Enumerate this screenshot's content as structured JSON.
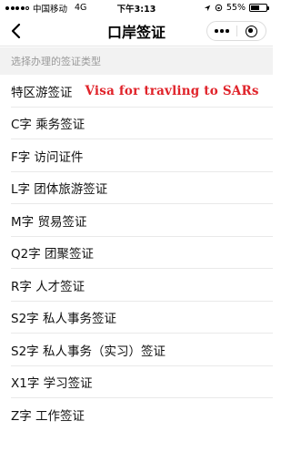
{
  "status_bar": {
    "carrier": "中国移动",
    "network": "4G",
    "time": "下午3:13",
    "battery": "55%",
    "battery_level": 0.55
  },
  "nav": {
    "title": "口岸签证",
    "back_icon": "chevron-left-icon",
    "more_icon": "more-dots-icon",
    "close_icon": "target-circle-icon"
  },
  "section": {
    "header": "选择办理的签证类型"
  },
  "visa_types": [
    {
      "label": "特区游签证",
      "note": "Visa for travling to SARs"
    },
    {
      "label": "C字 乘务签证"
    },
    {
      "label": "F字 访问证件"
    },
    {
      "label": "L字 团体旅游签证"
    },
    {
      "label": "M字 贸易签证"
    },
    {
      "label": "Q2字 团聚签证"
    },
    {
      "label": "R字 人才签证"
    },
    {
      "label": "S2字 私人事务签证"
    },
    {
      "label": "S2字 私人事务（实习）签证"
    },
    {
      "label": "X1字 学习签证"
    },
    {
      "label": "Z字 工作签证"
    }
  ],
  "colors": {
    "annotation": "#e0232a",
    "section_bg": "#f2f2f2",
    "section_text": "#999999"
  }
}
